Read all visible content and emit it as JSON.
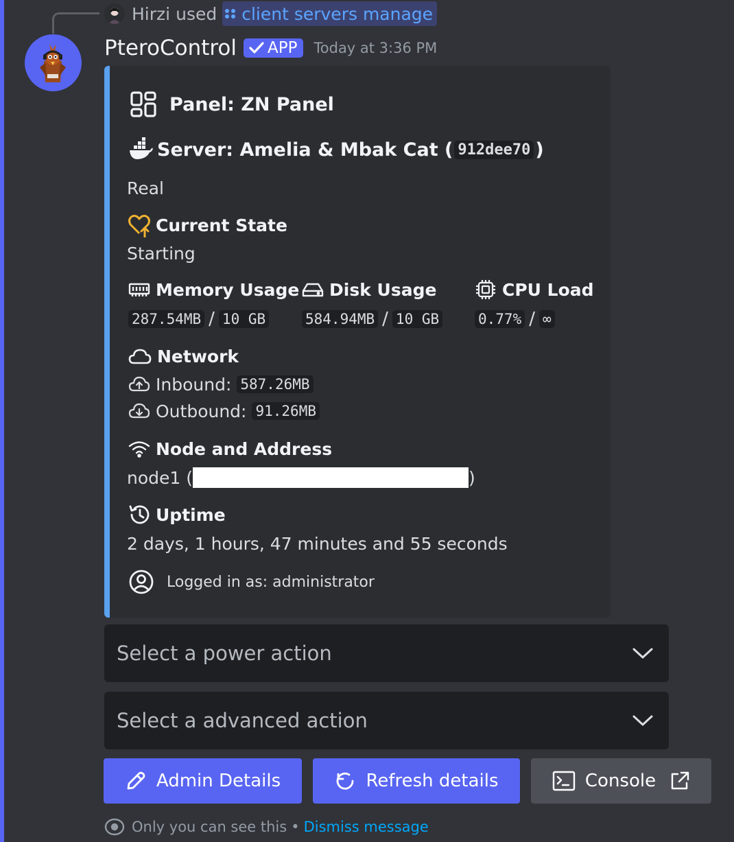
{
  "command_context": {
    "user_name": "Hirzi",
    "action_text": "used",
    "command_name": "client servers manage"
  },
  "message": {
    "author": "PteroControl",
    "badge": "APP",
    "timestamp": "Today at 3:36 PM"
  },
  "embed": {
    "accent_color": "#5aa1f0",
    "panel": "Panel: ZN Panel",
    "server_label": "Server: Amelia & Mbak Cat (",
    "server_id": "912dee70",
    "server_close": ")",
    "description": "Real",
    "state_title": "Current State",
    "state_value": "Starting",
    "memory": {
      "title": "Memory Usage",
      "used": "287.54MB",
      "sep": "/",
      "total": "10 GB"
    },
    "disk": {
      "title": "Disk Usage",
      "used": "584.94MB",
      "sep": "/",
      "total": "10 GB"
    },
    "cpu": {
      "title": "CPU Load",
      "used": "0.77%",
      "sep": "/",
      "total": "∞"
    },
    "network": {
      "title": "Network",
      "inbound_label": "Inbound:",
      "inbound_value": "587.26MB",
      "outbound_label": "Outbound:",
      "outbound_value": "91.26MB"
    },
    "node": {
      "title": "Node and Address",
      "prefix": "node1 (",
      "suffix": ")"
    },
    "uptime": {
      "title": "Uptime",
      "value": "2 days, 1 hours, 47 minutes and 55 seconds"
    },
    "footer": "Logged in as: administrator"
  },
  "selects": {
    "power": {
      "placeholder": "Select a power action"
    },
    "advanced": {
      "placeholder": "Select a advanced action"
    }
  },
  "buttons": {
    "admin": "Admin Details",
    "refresh": "Refresh details",
    "console": "Console"
  },
  "ephemeral": {
    "notice": "Only you can see this",
    "separator": "•",
    "dismiss": "Dismiss message"
  },
  "icons": {
    "panel": "dashboard-icon",
    "server": "docker-icon",
    "state": "heart-icon",
    "memory": "memory-icon",
    "disk": "hard-drive-icon",
    "cpu": "cpu-icon",
    "network": "cloud-icon",
    "inbound": "cloud-upload-icon",
    "outbound": "cloud-download-icon",
    "node": "wifi-icon",
    "uptime": "history-icon",
    "footer": "user-circle-icon",
    "admin": "pencil-icon",
    "refresh": "refresh-icon",
    "console": "terminal-icon",
    "console_external": "external-link-icon",
    "ephemeral": "eye-icon"
  },
  "colors": {
    "background": "#313338",
    "embed": "#2b2d31",
    "primary_button": "#5865f2",
    "secondary_button": "#4e5058",
    "link": "#00a8fc",
    "state_icon": "#f0b232"
  }
}
